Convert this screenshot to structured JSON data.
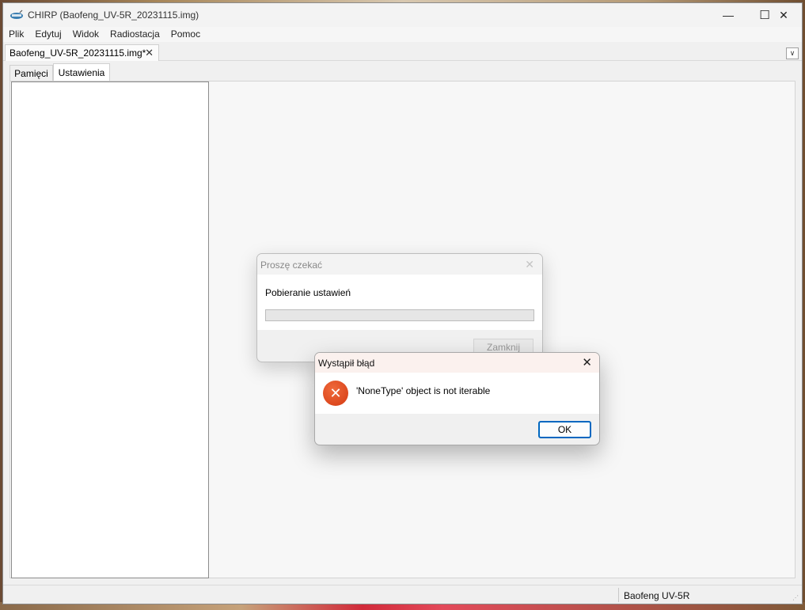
{
  "window": {
    "title": "CHIRP (Baofeng_UV-5R_20231115.img)",
    "app_icon": "chirp-radio-icon",
    "minimize_icon": "—",
    "maximize_icon": "☐",
    "close_icon": "✕"
  },
  "menu": [
    "Plik",
    "Edytuj",
    "Widok",
    "Radiostacja",
    "Pomoc"
  ],
  "doc_tab": {
    "label": "Baofeng_UV-5R_20231115.img*",
    "close_icon": "✕",
    "dropdown_icon": "∨"
  },
  "subtabs": [
    {
      "label": "Pamięci",
      "active": false
    },
    {
      "label": "Ustawienia",
      "active": true
    }
  ],
  "status": {
    "radio": "Baofeng UV-5R"
  },
  "progress_dialog": {
    "title": "Proszę czekać",
    "message": "Pobieranie ustawień",
    "progress": 0,
    "close_button": "Zamknij",
    "close_icon": "✕"
  },
  "error_dialog": {
    "title": "Wystąpił błąd",
    "message": "'NoneType' object is not iterable",
    "ok_button": "OK",
    "close_icon": "✕",
    "error_icon": "✕"
  },
  "colors": {
    "ok_border": "#0067c0",
    "error_icon": "#d43a12"
  }
}
